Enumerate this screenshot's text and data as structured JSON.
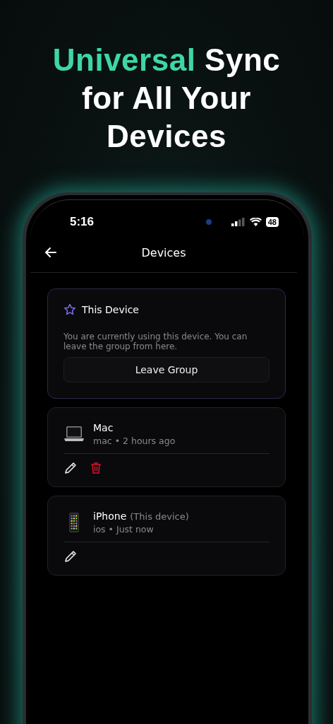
{
  "headline": [
    {
      "text": "Universal",
      "highlight": true
    },
    {
      "text": " Sync for All Your Devices",
      "highlight": false
    }
  ],
  "status_bar": {
    "time": "5:16",
    "battery": "48"
  },
  "nav": {
    "title": "Devices"
  },
  "this_device": {
    "title": "This Device",
    "description": "You are currently using this device. You can leave the group from here.",
    "button": "Leave Group"
  },
  "devices": [
    {
      "kind": "laptop",
      "name": "Mac",
      "meta": "mac • 2 hours ago",
      "actions": [
        {
          "kind": "edit"
        },
        {
          "kind": "delete"
        }
      ]
    },
    {
      "kind": "phone",
      "name": "iPhone",
      "tag": "(This device)",
      "meta": "ios • Just now",
      "actions": [
        {
          "kind": "edit"
        }
      ]
    }
  ]
}
